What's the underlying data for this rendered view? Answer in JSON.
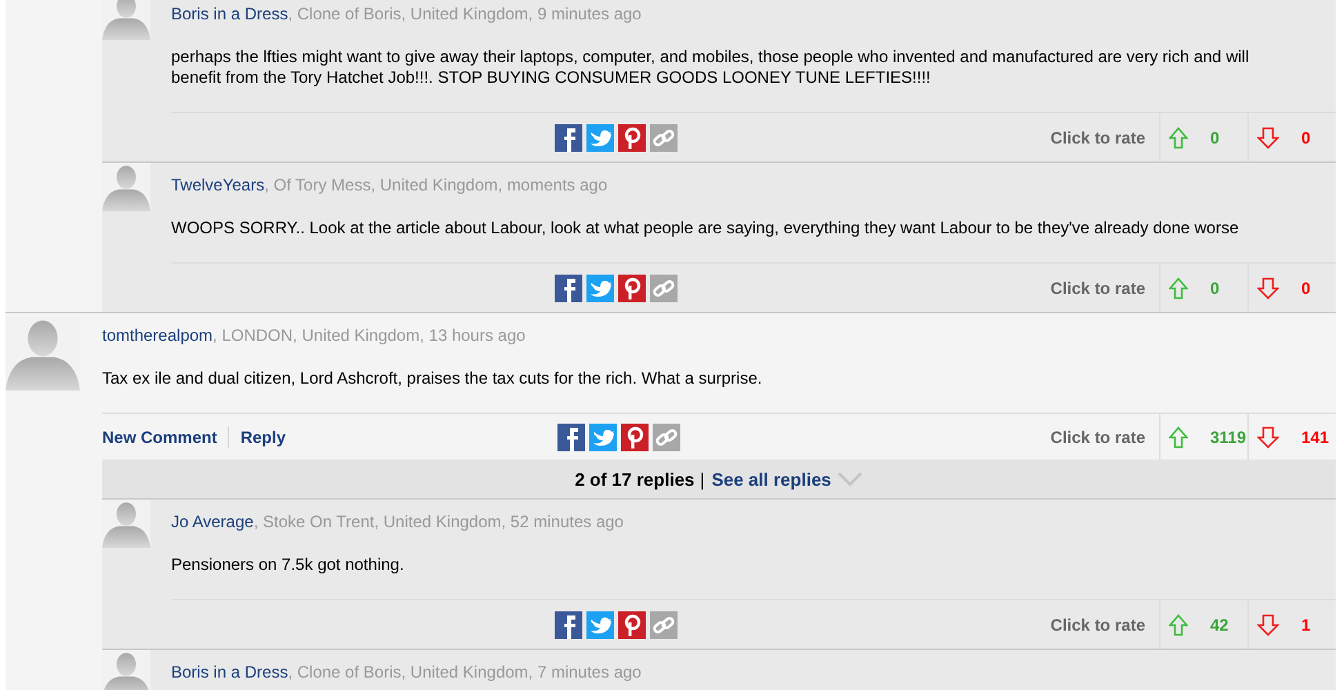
{
  "previous_replies": [
    {
      "author": "Boris in a Dress",
      "details": ", Clone of Boris, United Kingdom, 9 minutes ago",
      "text": "perhaps the lfties might want to give away their laptops, computer, and mobiles, those people who invented and manufactured are very rich and will benefit from the Tory Hatchet Job!!!. STOP BUYING CONSUMER GOODS LOONEY TUNE LEFTIES!!!!",
      "rate_label": "Click to rate",
      "up": "0",
      "down": "0"
    },
    {
      "author": "TwelveYears",
      "details": ", Of Tory Mess, United Kingdom, moments ago",
      "text": "WOOPS SORRY.. Look at the article about Labour, look at what people are saying, everything they want Labour to be they've already done worse",
      "rate_label": "Click to rate",
      "up": "0",
      "down": "0"
    }
  ],
  "comment": {
    "author": "tomtherealpom",
    "details": ", LONDON, United Kingdom, 13 hours ago",
    "text": "Tax ex ile and dual citizen, Lord Ashcroft, praises the tax cuts for the rich. What a surprise.",
    "actions": [
      "New Comment",
      "Reply"
    ],
    "rate_label": "Click to rate",
    "up": "3119",
    "down": "141"
  },
  "replies_bar": {
    "count": "2 of 17 replies",
    "separator": "|",
    "see_all": "See all replies"
  },
  "replies": [
    {
      "author": "Jo Average",
      "details": ", Stoke On Trent, United Kingdom, 52 minutes ago",
      "text": "Pensioners on 7.5k got nothing.",
      "rate_label": "Click to rate",
      "up": "42",
      "down": "1"
    },
    {
      "author": "Boris in a Dress",
      "details": ", Clone of Boris, United Kingdom, 7 minutes ago"
    }
  ]
}
